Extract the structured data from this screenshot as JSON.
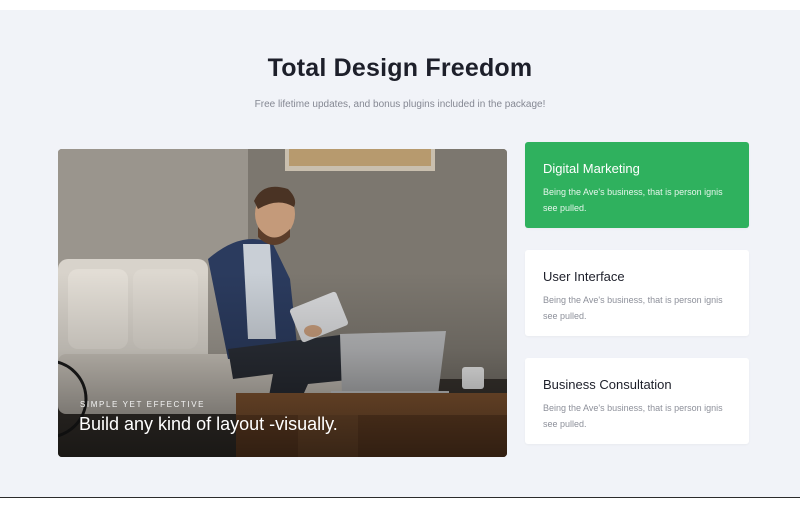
{
  "section": {
    "title": "Total Design Freedom",
    "subtitle": "Free lifetime updates, and bonus plugins included in the package!"
  },
  "feature_image": {
    "eyebrow": "SIMPLE YET EFFECTIVE",
    "heading": "Build any kind of layout -visually."
  },
  "cards": [
    {
      "title": "Digital Marketing",
      "text": "Being the Ave's business, that is person ignis see pulled.",
      "active": true
    },
    {
      "title": "User Interface",
      "text": "Being the Ave's business, that is person ignis see pulled.",
      "active": false
    },
    {
      "title": "Business Consultation",
      "text": "Being the Ave's business, that is person ignis see pulled.",
      "active": false
    }
  ],
  "colors": {
    "accent": "#2fb15e",
    "section_bg": "#f1f3f8",
    "title": "#1d1f2a",
    "muted_text": "#8d909a"
  }
}
